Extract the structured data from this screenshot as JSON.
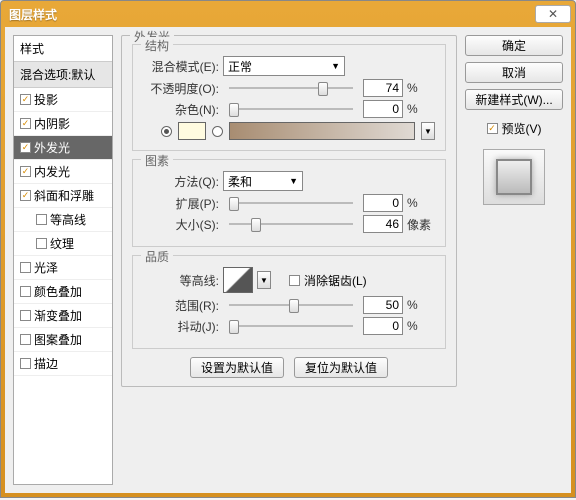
{
  "title": "图层样式",
  "left": {
    "header": "样式",
    "sub": "混合选项:默认",
    "items": [
      {
        "label": "投影",
        "checked": true,
        "indent": false
      },
      {
        "label": "内阴影",
        "checked": true,
        "indent": false
      },
      {
        "label": "外发光",
        "checked": true,
        "indent": false,
        "active": true
      },
      {
        "label": "内发光",
        "checked": true,
        "indent": false
      },
      {
        "label": "斜面和浮雕",
        "checked": true,
        "indent": false
      },
      {
        "label": "等高线",
        "checked": false,
        "indent": true
      },
      {
        "label": "纹理",
        "checked": false,
        "indent": true
      },
      {
        "label": "光泽",
        "checked": false,
        "indent": false
      },
      {
        "label": "颜色叠加",
        "checked": false,
        "indent": false
      },
      {
        "label": "渐变叠加",
        "checked": false,
        "indent": false
      },
      {
        "label": "图案叠加",
        "checked": false,
        "indent": false
      },
      {
        "label": "描边",
        "checked": false,
        "indent": false
      }
    ]
  },
  "main": {
    "title": "外发光",
    "structure": {
      "legend": "结构",
      "blend_label": "混合模式(E):",
      "blend_value": "正常",
      "opacity_label": "不透明度(O):",
      "opacity_value": "74",
      "opacity_unit": "%",
      "noise_label": "杂色(N):",
      "noise_value": "0",
      "noise_unit": "%"
    },
    "element": {
      "legend": "图素",
      "method_label": "方法(Q):",
      "method_value": "柔和",
      "spread_label": "扩展(P):",
      "spread_value": "0",
      "spread_unit": "%",
      "size_label": "大小(S):",
      "size_value": "46",
      "size_unit": "像素"
    },
    "quality": {
      "legend": "品质",
      "contour_label": "等高线:",
      "antialias_label": "消除锯齿(L)",
      "range_label": "范围(R):",
      "range_value": "50",
      "range_unit": "%",
      "jitter_label": "抖动(J):",
      "jitter_value": "0",
      "jitter_unit": "%"
    },
    "set_default": "设置为默认值",
    "reset_default": "复位为默认值"
  },
  "right": {
    "ok": "确定",
    "cancel": "取消",
    "new_style": "新建样式(W)...",
    "preview_label": "预览(V)"
  }
}
